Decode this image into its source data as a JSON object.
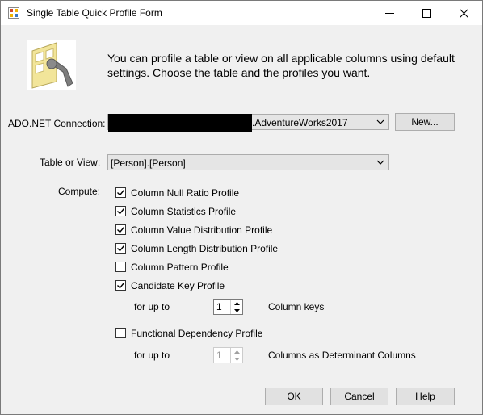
{
  "window": {
    "title": "Single Table Quick Profile Form",
    "intro_text": "You can profile a table or view on all applicable columns using default settings. Choose the table and the profiles you want."
  },
  "connection": {
    "label": "ADO.NET Connection:",
    "value": ".AdventureWorks2017",
    "new_button": "New..."
  },
  "table": {
    "label": "Table or View:",
    "value": "[Person].[Person]"
  },
  "compute": {
    "label": "Compute:",
    "profiles": [
      {
        "label": "Column Null Ratio Profile",
        "checked": true
      },
      {
        "label": "Column Statistics Profile",
        "checked": true
      },
      {
        "label": "Column Value Distribution Profile",
        "checked": true
      },
      {
        "label": "Column Length Distribution Profile",
        "checked": true
      },
      {
        "label": "Column Pattern Profile",
        "checked": false
      },
      {
        "label": "Candidate Key Profile",
        "checked": true
      }
    ],
    "candidate_key": {
      "for_up_to": "for up to",
      "value": "1",
      "suffix": "Column keys"
    },
    "functional_dependency": {
      "label": "Functional Dependency Profile",
      "checked": false,
      "for_up_to": "for up to",
      "value": "1",
      "suffix": "Columns as Determinant Columns"
    }
  },
  "buttons": {
    "ok": "OK",
    "cancel": "Cancel",
    "help": "Help"
  },
  "icons": {
    "app": "table-profile-app-icon",
    "wizard": "table-wrench-icon"
  }
}
